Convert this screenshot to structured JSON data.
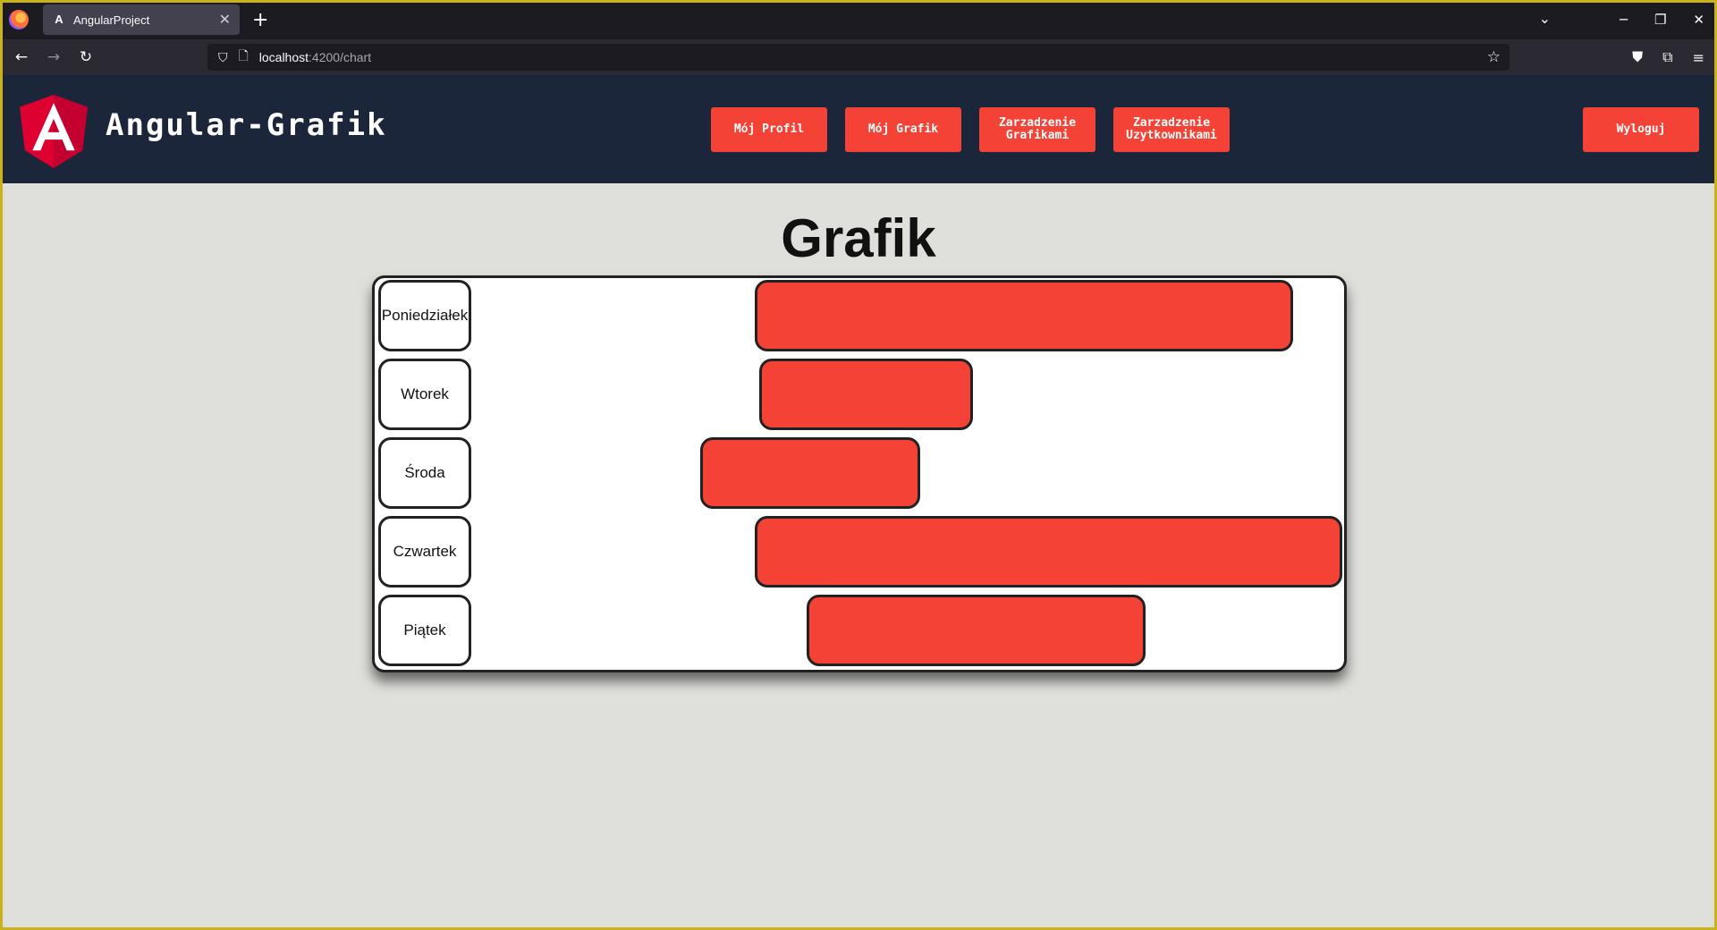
{
  "browser": {
    "tab_title": "AngularProject",
    "tab_favicon": "A",
    "url_host": "localhost",
    "url_path": ":4200/chart",
    "icons": [
      "firefox-icon",
      "close-icon",
      "plus-icon",
      "back-icon",
      "forward-icon",
      "reload-icon",
      "shield-icon",
      "page-icon",
      "star-icon",
      "pocket-icon",
      "extensions-icon",
      "menu-icon",
      "minimize-icon",
      "restore-icon",
      "window-close-icon",
      "chevron-down-icon"
    ]
  },
  "header": {
    "brand": "Angular-Grafik",
    "nav": [
      {
        "label": "Mój Profil"
      },
      {
        "label": "Mój Grafik"
      },
      {
        "label": "Zarzadzenie Grafikami"
      },
      {
        "label": "Zarzadzenie Uzytkownikami"
      }
    ],
    "logout": "Wyloguj",
    "accent_color": "#f44336",
    "bg_color": "#1b263b"
  },
  "main": {
    "title": "Grafik"
  },
  "schedule": {
    "bar_color": "#f44336",
    "days": [
      {
        "label": "Poniedziałek",
        "start": 0.392,
        "end": 0.949
      },
      {
        "label": "Wtorek",
        "start": 0.397,
        "end": 0.619
      },
      {
        "label": "Środa",
        "start": 0.336,
        "end": 0.565
      },
      {
        "label": "Czwartek",
        "start": 0.392,
        "end": 1.0
      },
      {
        "label": "Piątek",
        "start": 0.446,
        "end": 0.797
      }
    ]
  }
}
